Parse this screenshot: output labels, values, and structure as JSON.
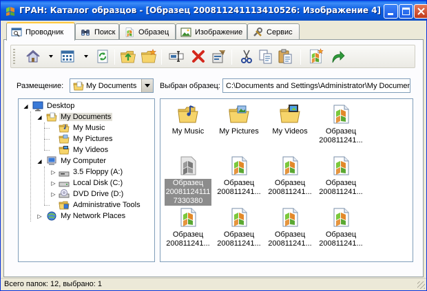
{
  "window": {
    "title": "ГРАН: Каталог образцов - [Образец 200811241113410526: Изображение 4]",
    "titlebar_colors": [
      "#0a5ee9",
      "#0858d9"
    ]
  },
  "tabs": [
    {
      "label": "Проводник",
      "icon": "explorer-icon",
      "active": true
    },
    {
      "label": "Поиск",
      "icon": "binoculars-icon"
    },
    {
      "label": "Образец",
      "icon": "sample-icon"
    },
    {
      "label": "Изображение",
      "icon": "image-icon"
    },
    {
      "label": "Сервис",
      "icon": "tools-icon"
    }
  ],
  "toolbar": {
    "buttons": [
      "home-icon",
      "view-grid-icon",
      "refresh-icon",
      "folder-up-icon",
      "new-folder-icon",
      "rename-icon",
      "delete-icon",
      "properties-icon",
      "cut-icon",
      "copy-icon",
      "paste-icon",
      "new-sample-icon",
      "go-icon"
    ]
  },
  "location": {
    "label": "Размещение:",
    "value": "My Documents",
    "selected_label": "Выбран образец:",
    "selected_path": "C:\\Documents and Settings\\Administrator\\My Documents"
  },
  "tree": [
    {
      "label": "Desktop",
      "icon": "desktop-icon",
      "level": 0
    },
    {
      "label": "My Documents",
      "icon": "folder-docs-icon",
      "level": 1,
      "selected": true
    },
    {
      "label": "My Music",
      "icon": "folder-music-icon",
      "level": 2
    },
    {
      "label": "My Pictures",
      "icon": "folder-pictures-icon",
      "level": 2
    },
    {
      "label": "My Videos",
      "icon": "folder-videos-icon",
      "level": 2
    },
    {
      "label": "My Computer",
      "icon": "computer-icon",
      "level": 1
    },
    {
      "label": "3.5 Floppy (A:)",
      "icon": "floppy-icon",
      "level": 2
    },
    {
      "label": "Local Disk (C:)",
      "icon": "disk-icon",
      "level": 2
    },
    {
      "label": "DVD Drive (D:)",
      "icon": "dvd-icon",
      "level": 2
    },
    {
      "label": "Administrative Tools",
      "icon": "admin-tools-icon",
      "level": 2
    },
    {
      "label": "My Network Places",
      "icon": "network-icon",
      "level": 1
    }
  ],
  "thumbnails": [
    {
      "line1": "My Music",
      "line2": "",
      "icon": "folder-music-icon"
    },
    {
      "line1": "My Pictures",
      "line2": "",
      "icon": "folder-pictures-icon"
    },
    {
      "line1": "My Videos",
      "line2": "",
      "icon": "folder-videos-icon"
    },
    {
      "line1": "Образец",
      "line2": "200811241...",
      "icon": "sample-icon"
    },
    {
      "line1": "Образец",
      "line2": "20081124111",
      "line3": "7330380",
      "icon": "sample-icon",
      "selected": true
    },
    {
      "line1": "Образец",
      "line2": "200811241...",
      "icon": "sample-icon"
    },
    {
      "line1": "Образец",
      "line2": "200811241...",
      "icon": "sample-icon"
    },
    {
      "line1": "Образец",
      "line2": "200811241...",
      "icon": "sample-icon"
    },
    {
      "line1": "Образец",
      "line2": "200811241...",
      "icon": "sample-icon"
    },
    {
      "line1": "Образец",
      "line2": "200811241...",
      "icon": "sample-icon"
    },
    {
      "line1": "Образец",
      "line2": "200811241...",
      "icon": "sample-icon"
    },
    {
      "line1": "Образец",
      "line2": "200811241...",
      "icon": "sample-icon"
    }
  ],
  "status": {
    "text": "Всего папок: 12, выбрано: 1"
  }
}
